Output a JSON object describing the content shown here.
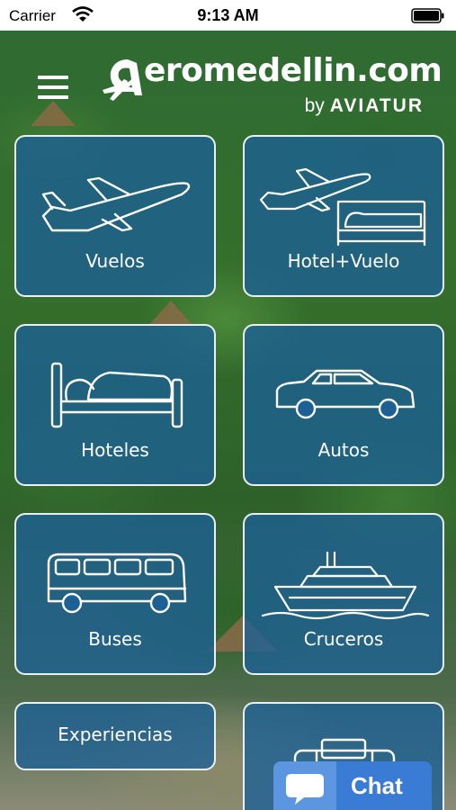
{
  "status_bar": {
    "carrier": "Carrier",
    "time": "9:13 AM"
  },
  "header": {
    "logo_main": "eromedellin.com",
    "logo_by": "by",
    "logo_brand": "AVIATUR"
  },
  "tiles": [
    {
      "label": "Vuelos",
      "icon": "airplane-icon"
    },
    {
      "label": "Hotel+Vuelo",
      "icon": "hotel-flight-icon"
    },
    {
      "label": "Hoteles",
      "icon": "bed-icon"
    },
    {
      "label": "Autos",
      "icon": "car-icon"
    },
    {
      "label": "Buses",
      "icon": "bus-icon"
    },
    {
      "label": "Cruceros",
      "icon": "ship-icon"
    },
    {
      "label": "Experiencias",
      "icon": ""
    },
    {
      "label": "",
      "icon": "luggage-icon"
    }
  ],
  "chat": {
    "label": "Chat",
    "icon": "chat-bubble-icon"
  }
}
